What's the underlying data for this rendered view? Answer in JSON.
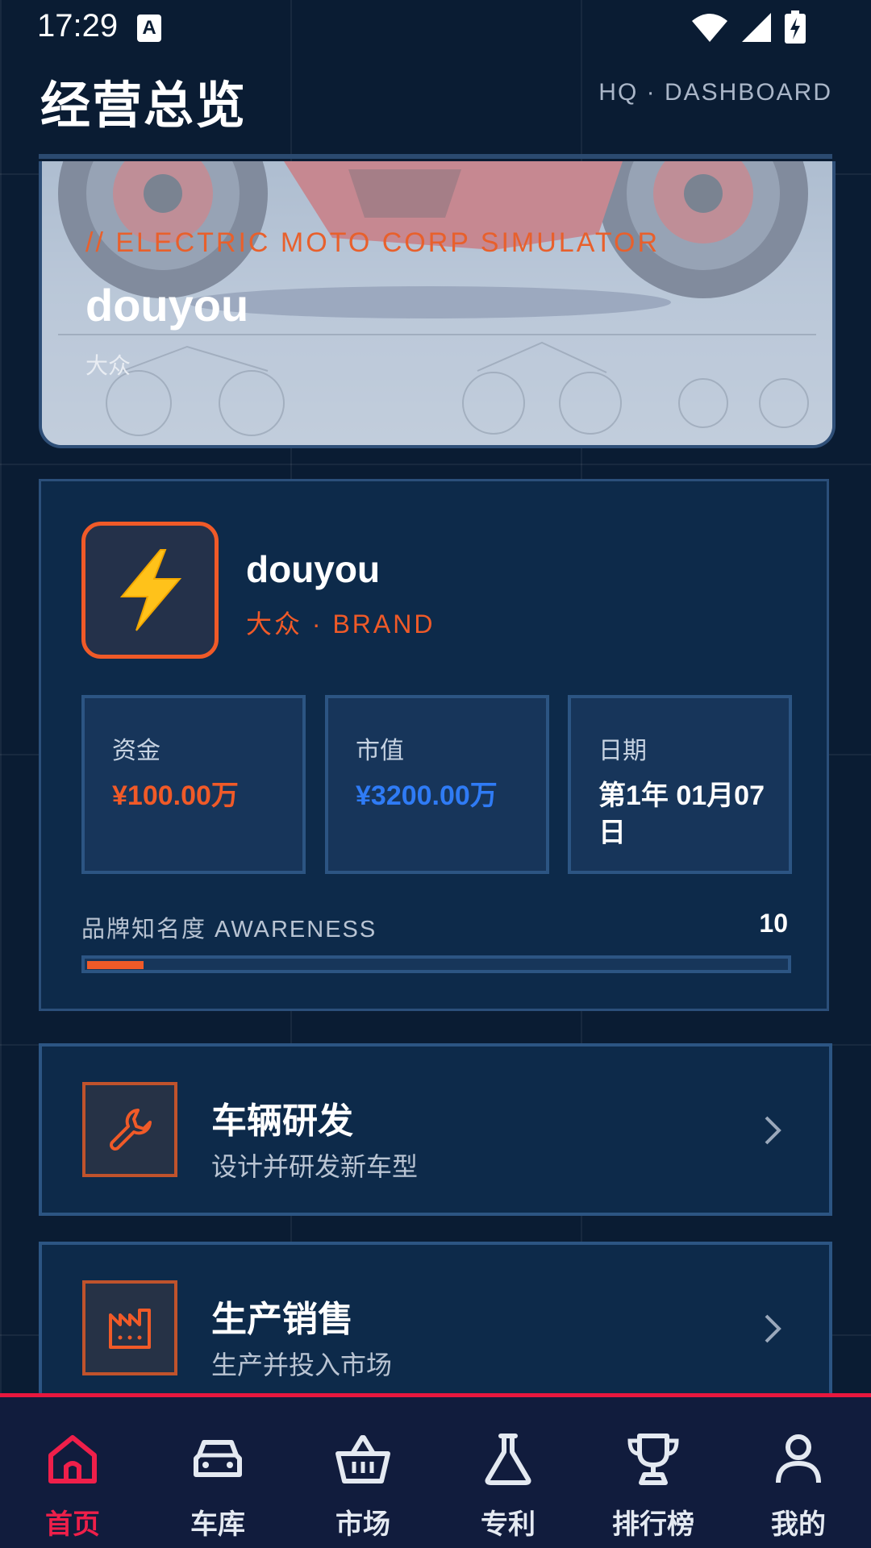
{
  "status_bar": {
    "time": "17:29",
    "notification_icon": "a-icon",
    "icons": [
      "wifi-icon",
      "signal-icon",
      "battery-charging-icon"
    ]
  },
  "header": {
    "title": "经营总览",
    "subtitle": "HQ · DASHBOARD"
  },
  "banner": {
    "tagline": "// ELECTRIC MOTO CORP SIMULATOR",
    "company_name": "douyou",
    "brand_sub": "大众"
  },
  "brand_card": {
    "logo_icon": "lightning-icon",
    "name": "douyou",
    "tag": "大众 · BRAND",
    "stats": [
      {
        "label": "资金",
        "value": "¥100.00万",
        "color": "#f05a28"
      },
      {
        "label": "市值",
        "value": "¥3200.00万",
        "color": "#2f7bf5"
      },
      {
        "label": "日期",
        "value": "第1年 01月07日",
        "color": "#ffffff"
      }
    ],
    "awareness": {
      "label": "品牌知名度 AWARENESS",
      "value": "10",
      "fraction": 0.08
    }
  },
  "features": [
    {
      "title": "车辆研发",
      "desc": "设计并研发新车型",
      "icon": "wrench-icon"
    },
    {
      "title": "生产销售",
      "desc": "生产并投入市场",
      "icon": "factory-icon"
    }
  ],
  "nav": {
    "items": [
      {
        "label": "首页",
        "icon": "home-icon",
        "active": true
      },
      {
        "label": "车库",
        "icon": "car-icon",
        "active": false
      },
      {
        "label": "市场",
        "icon": "basket-icon",
        "active": false
      },
      {
        "label": "专利",
        "icon": "flask-icon",
        "active": false
      },
      {
        "label": "排行榜",
        "icon": "trophy-icon",
        "active": false
      },
      {
        "label": "我的",
        "icon": "user-icon",
        "active": false
      }
    ]
  },
  "colors": {
    "background": "#0a1c33",
    "accent_orange": "#f05a28",
    "accent_blue": "#2f7bf5",
    "nav_active": "#ef1f4a"
  }
}
